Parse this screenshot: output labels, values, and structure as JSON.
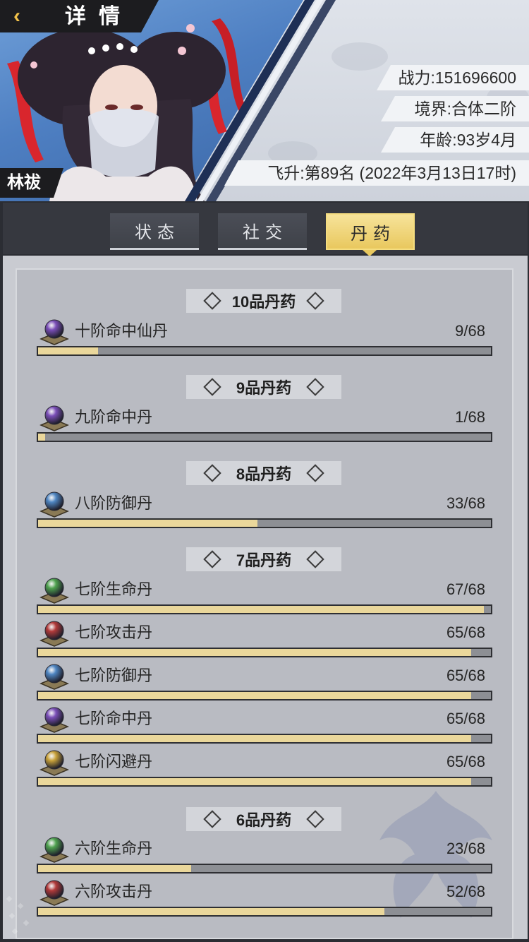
{
  "header": {
    "title": "详情",
    "character_name": "林祓",
    "stats": {
      "power": "战力:151696600",
      "realm": "境界:合体二阶",
      "age": "年龄:93岁4月",
      "ascension": "飞升:第89名 (2022年3月13日17时)"
    }
  },
  "tabs": [
    {
      "label": "状态",
      "active": false
    },
    {
      "label": "社交",
      "active": false
    },
    {
      "label": "丹药",
      "active": true
    }
  ],
  "colors": {
    "accent_gold": "#e9c85e",
    "bar_fill": "#ead79b",
    "bar_track": "#8d8f94",
    "pill_purple": "#7b4fb8",
    "pill_blue": "#4f86c2",
    "pill_green": "#4fa24f",
    "pill_red": "#b23a3a",
    "pill_gold": "#c9a23a"
  },
  "sections": [
    {
      "title": "10品丹药",
      "items": [
        {
          "name": "十阶命中仙丹",
          "count": "9/68",
          "progress": 0.132,
          "pill": "purple"
        }
      ]
    },
    {
      "title": "9品丹药",
      "items": [
        {
          "name": "九阶命中丹",
          "count": "1/68",
          "progress": 0.015,
          "pill": "purple"
        }
      ]
    },
    {
      "title": "8品丹药",
      "items": [
        {
          "name": "八阶防御丹",
          "count": "33/68",
          "progress": 0.485,
          "pill": "blue"
        }
      ]
    },
    {
      "title": "7品丹药",
      "items": [
        {
          "name": "七阶生命丹",
          "count": "67/68",
          "progress": 0.985,
          "pill": "green"
        },
        {
          "name": "七阶攻击丹",
          "count": "65/68",
          "progress": 0.956,
          "pill": "red"
        },
        {
          "name": "七阶防御丹",
          "count": "65/68",
          "progress": 0.956,
          "pill": "blue"
        },
        {
          "name": "七阶命中丹",
          "count": "65/68",
          "progress": 0.956,
          "pill": "purple"
        },
        {
          "name": "七阶闪避丹",
          "count": "65/68",
          "progress": 0.956,
          "pill": "gold"
        }
      ]
    },
    {
      "title": "6品丹药",
      "items": [
        {
          "name": "六阶生命丹",
          "count": "23/68",
          "progress": 0.338,
          "pill": "green"
        },
        {
          "name": "六阶攻击丹",
          "count": "52/68",
          "progress": 0.765,
          "pill": "red"
        }
      ]
    }
  ]
}
